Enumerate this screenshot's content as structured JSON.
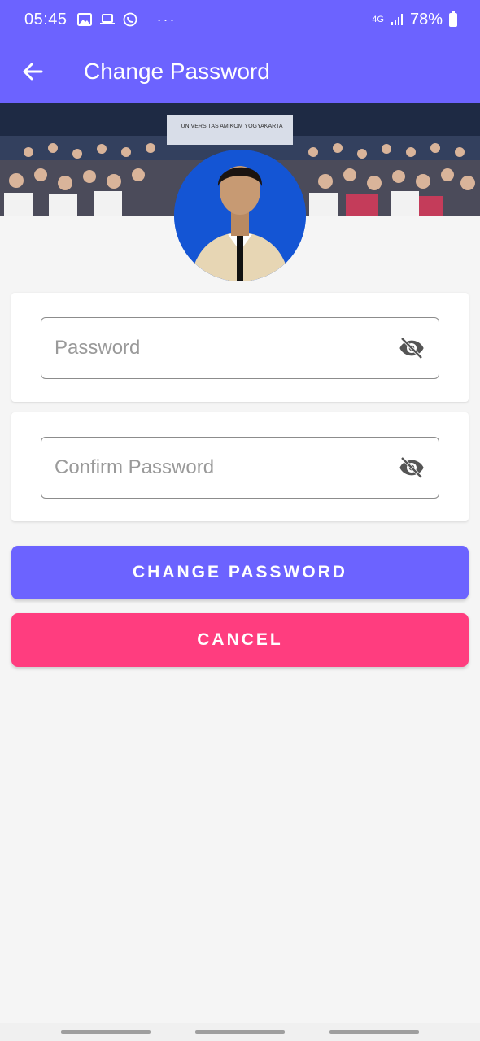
{
  "status_bar": {
    "time": "05:45",
    "network": "4G",
    "battery": "78%",
    "more": "···",
    "icons": [
      "image-icon",
      "laptop-icon",
      "whatsapp-icon",
      "signal-icon",
      "battery-icon"
    ]
  },
  "app_bar": {
    "title": "Change Password",
    "back_icon": "arrow-back-icon"
  },
  "banner": {
    "caption": "UNIVERSITAS AMIKOM YOGYAKARTA"
  },
  "form": {
    "password": {
      "placeholder": "Password",
      "value": ""
    },
    "confirm_password": {
      "placeholder": "Confirm Password",
      "value": ""
    },
    "toggle_icon": "visibility-off-icon"
  },
  "buttons": {
    "change_password": "CHANGE PASSWORD",
    "cancel": "CANCEL"
  },
  "colors": {
    "primary": "#6c63ff",
    "accent": "#ff3d7f",
    "background": "#f5f5f5"
  }
}
